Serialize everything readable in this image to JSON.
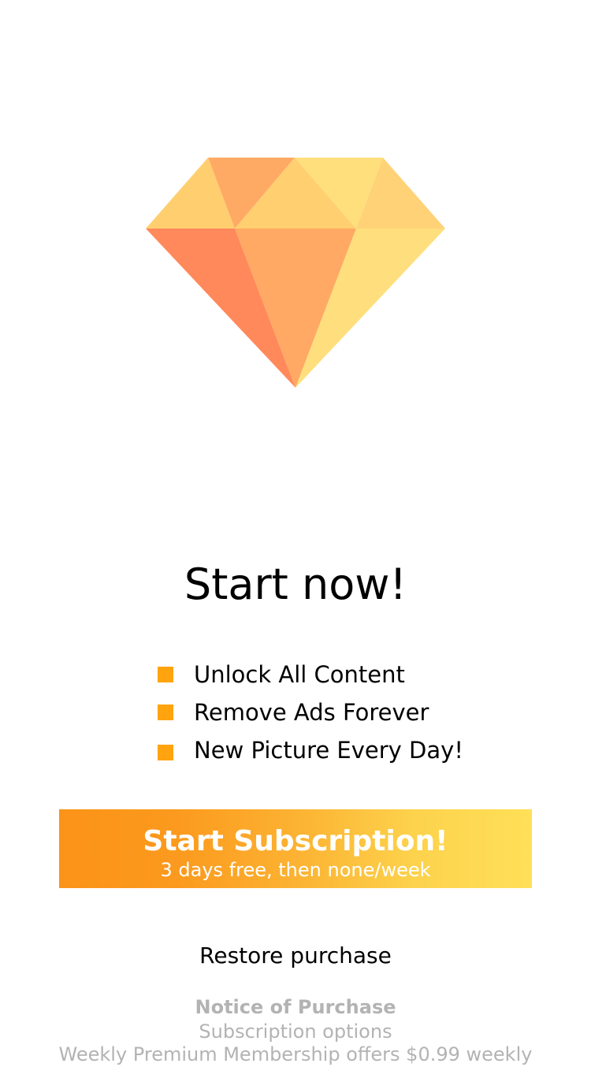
{
  "hero": {
    "icon": "diamond-icon",
    "colors": [
      "#ffcf6f",
      "#ffaa64",
      "#ffdd7a",
      "#ff8a5b"
    ]
  },
  "headline": "Start now!",
  "features": [
    {
      "label": "Unlock All Content"
    },
    {
      "label": "Remove Ads Forever"
    },
    {
      "label": "New Picture Every Day!"
    }
  ],
  "cta": {
    "title": "Start Subscription!",
    "subtitle": "3 days free, then none/week",
    "gradient": [
      "#fb9318",
      "#ffe058"
    ]
  },
  "restore_label": "Restore purchase",
  "notice": {
    "title": "Notice of Purchase",
    "subtitle": "Subscription options",
    "cut_line": "Weekly Premium Membership offers $0.99 weekly"
  },
  "accent_color": "#ffa30f"
}
